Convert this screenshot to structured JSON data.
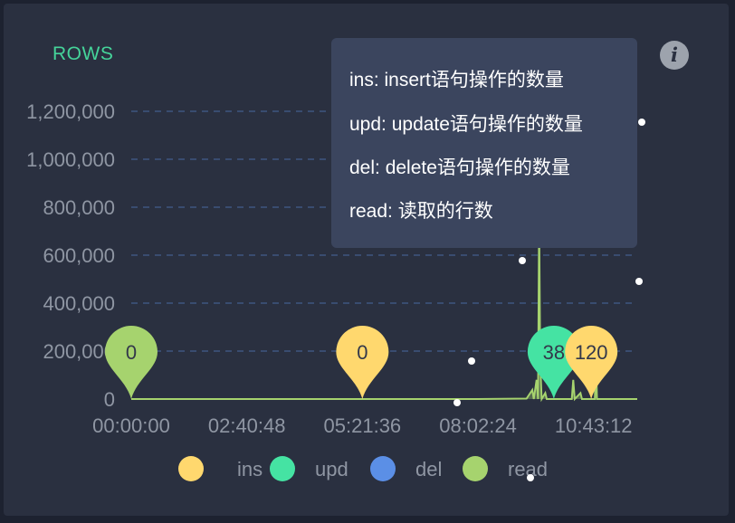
{
  "panel": {
    "title": "ROWS",
    "info_icon": "info-icon",
    "info_glyph": "i"
  },
  "tooltip": {
    "lines": [
      "ins: insert语句操作的数量",
      "upd: update语句操作的数量",
      "del: delete语句操作的数量",
      "read: 读取的行数"
    ]
  },
  "chart_data": {
    "type": "area",
    "x_ticks": [
      "00:00:00",
      "02:40:48",
      "05:21:36",
      "08:02:24",
      "10:43:12"
    ],
    "x_range": [
      "00:00:00",
      "11:44:00"
    ],
    "y_ticks": [
      "0",
      "200,000",
      "400,000",
      "600,000",
      "800,000",
      "1,000,000",
      "1,200,000"
    ],
    "ylim": [
      0,
      1200000
    ],
    "grid": true,
    "legend_position": "bottom",
    "series": [
      {
        "name": "ins",
        "color": "#ffd86e"
      },
      {
        "name": "upd",
        "color": "#45e3a3"
      },
      {
        "name": "del",
        "color": "#5b8fe6"
      },
      {
        "name": "read",
        "color": "#a6d36e",
        "points": [
          [
            "00:00:00",
            0
          ],
          [
            "08:02:24",
            0
          ],
          [
            "09:10:00",
            2000
          ],
          [
            "09:18:00",
            38000
          ],
          [
            "09:20:00",
            0
          ],
          [
            "09:24:00",
            80000
          ],
          [
            "09:26:00",
            0
          ],
          [
            "09:27:30",
            760000
          ],
          [
            "09:29:00",
            150000
          ],
          [
            "09:31:00",
            0
          ],
          [
            "09:36:00",
            25000
          ],
          [
            "09:38:00",
            0
          ],
          [
            "10:13:00",
            0
          ],
          [
            "10:15:00",
            80000
          ],
          [
            "10:17:00",
            0
          ],
          [
            "10:25:00",
            25000
          ],
          [
            "10:27:00",
            0
          ],
          [
            "10:45:00",
            0
          ],
          [
            "10:46:30",
            200000
          ],
          [
            "10:48:00",
            0
          ],
          [
            "11:44:00",
            0
          ]
        ]
      }
    ],
    "markers": [
      {
        "label": "0",
        "time": "00:00:00",
        "series": "read"
      },
      {
        "label": "0",
        "time": "05:21:36",
        "series": "ins"
      },
      {
        "label": "38",
        "time": "09:48:00",
        "series": "upd"
      },
      {
        "label": "120",
        "time": "10:40:00",
        "series": "ins"
      }
    ]
  }
}
